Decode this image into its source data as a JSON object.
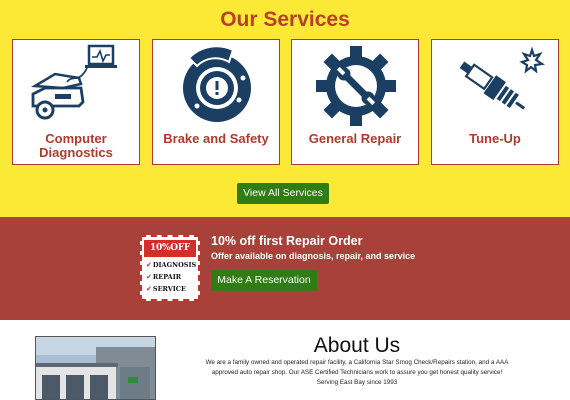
{
  "services": {
    "heading": "Our Services",
    "cards": [
      {
        "label": "Computer Diagnostics",
        "icon": "car-diagnostics-icon"
      },
      {
        "label": "Brake and Safety",
        "icon": "brake-disc-icon"
      },
      {
        "label": "General Repair",
        "icon": "gear-wrench-icon"
      },
      {
        "label": "Tune-Up",
        "icon": "spark-plug-icon"
      }
    ],
    "view_all_label": "View All Services"
  },
  "promo": {
    "coupon": {
      "badge": "10%OFF",
      "items": [
        "DIAGNOSIS",
        "REPAIR",
        "SERVICE"
      ]
    },
    "title": "10% off first Repair Order",
    "subtitle": "Offer available on diagnosis, repair, and service",
    "reserve_label": "Make A Reservation"
  },
  "about": {
    "heading": "About Us",
    "paragraph": "We are a family owned and operated repair facility, a California Star Smog Check/Repairs station, and a AAA approved auto repair shop. Our ASE Certified Technicians work to assure you get honest quality service!",
    "tagline": "Serving East Bay since 1993"
  },
  "colors": {
    "services_bg": "#fbe935",
    "accent_red": "#b03a2e",
    "promo_bg": "#a8413a",
    "button_green": "#2f7d14",
    "icon_navy": "#1b3e63"
  }
}
